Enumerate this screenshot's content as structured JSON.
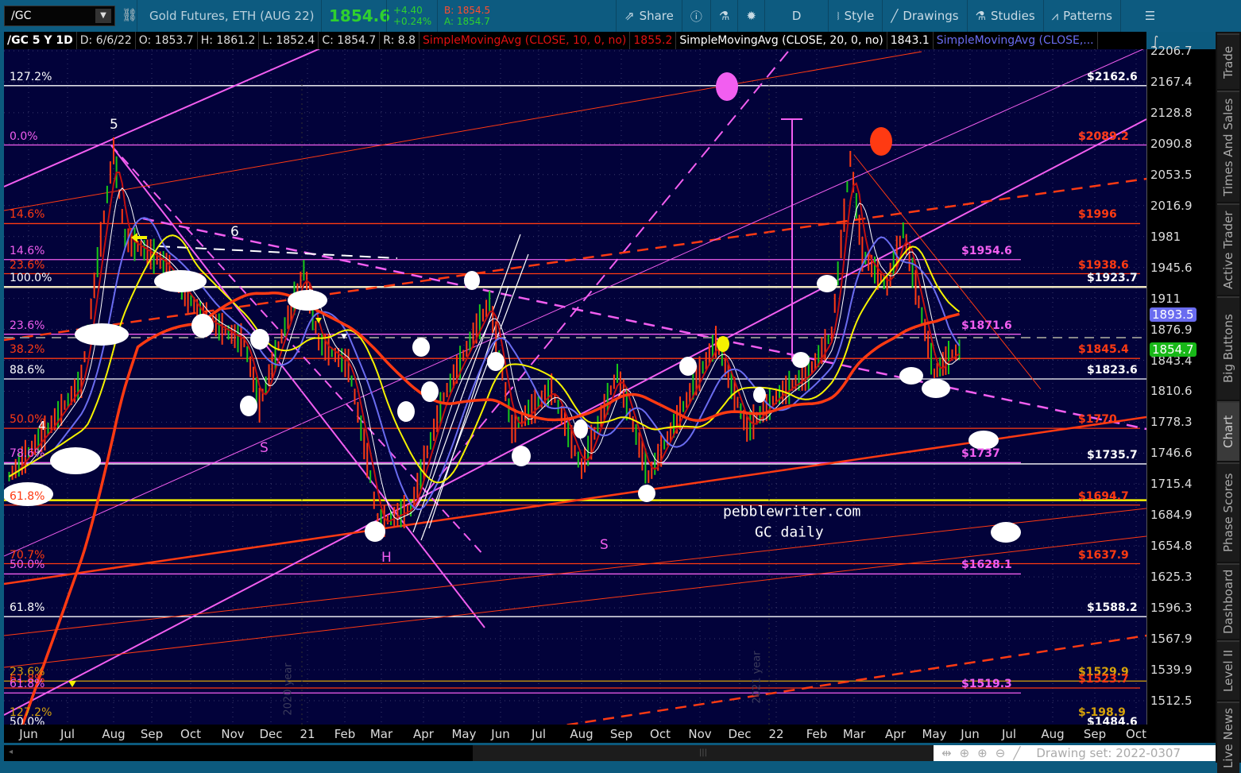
{
  "toolbar": {
    "symbol": "/GC",
    "description": "Gold Futures, ETH (AUG 22)",
    "last": "1854.6",
    "change": "+4.40",
    "change_pct": "+0.24%",
    "bid": "B: 1854.5",
    "ask": "A: 1854.7",
    "share": "Share",
    "aggregation": "D",
    "style": "Style",
    "drawings": "Drawings",
    "studies": "Studies",
    "patterns": "Patterns"
  },
  "infobar": {
    "title": "/GC 5 Y 1D",
    "date": "D: 6/6/22",
    "open": "O: 1853.7",
    "high": "H: 1861.2",
    "low": "L: 1852.4",
    "close": "C: 1854.7",
    "range": "R: 8.8",
    "sma10": "SimpleMovingAvg (CLOSE, 10, 0, no)",
    "sma10_val": "1855.2",
    "sma20": "SimpleMovingAvg (CLOSE, 20, 0, no)",
    "sma20_val": "1843.1",
    "sma_more": "SimpleMovingAvg (CLOSE,..."
  },
  "colors": {
    "white": "#ffffff",
    "pink": "#f25ef0",
    "orange": "#ff3a12",
    "gold": "#d6a20a",
    "yellow": "#f5f200",
    "cream": "#efe6c0",
    "blue": "#6a6cf0",
    "green": "#18b818",
    "bg": "#02023a"
  },
  "chart_data": {
    "type": "line",
    "title": "/GC 5 Y 1D",
    "y_ticks": [
      "2206.7",
      "2167.4",
      "2128.8",
      "2090.8",
      "2053.5",
      "2016.9",
      "1981",
      "1945.6",
      "1911",
      "1876.9",
      "1843.4",
      "1810.6",
      "1778.3",
      "1746.6",
      "1715.4",
      "1684.9",
      "1654.8",
      "1625.3",
      "1596.3",
      "1567.9",
      "1539.9",
      "1512.5"
    ],
    "x_ticks": [
      "Jun",
      "Jul",
      "Aug",
      "Sep",
      "Oct",
      "Nov",
      "Dec",
      "21",
      "Feb",
      "Mar",
      "Apr",
      "May",
      "Jun",
      "Jul",
      "Aug",
      "Sep",
      "Oct",
      "Nov",
      "Dec",
      "22",
      "Feb",
      "Mar",
      "Apr",
      "May",
      "Jun",
      "Jul",
      "Aug",
      "Sep",
      "Oct"
    ],
    "x_unit": "months since Jun 2020",
    "price": [
      [
        -0.5,
        1722.9
      ],
      [
        0.5,
        1771.3
      ],
      [
        1.3,
        1821.1
      ],
      [
        2.0,
        2082.2
      ],
      [
        2.3,
        1978.9
      ],
      [
        3.3,
        1951.6
      ],
      [
        4.3,
        1889.5
      ],
      [
        5.3,
        1863.5
      ],
      [
        5.7,
        1796.1
      ],
      [
        6.9,
        1942.5
      ],
      [
        7.3,
        1863.5
      ],
      [
        8.1,
        1837.8
      ],
      [
        8.7,
        1722.9
      ],
      [
        8.9,
        1675.9
      ],
      [
        9.7,
        1691.3
      ],
      [
        10.5,
        1804.5
      ],
      [
        11.7,
        1907.2
      ],
      [
        12.3,
        1771.3
      ],
      [
        13.3,
        1812.6
      ],
      [
        14.0,
        1731.0
      ],
      [
        14.9,
        1829.6
      ],
      [
        15.7,
        1722.9
      ],
      [
        16.5,
        1787.7
      ],
      [
        17.4,
        1863.5
      ],
      [
        18.2,
        1771.3
      ],
      [
        19.0,
        1804.5
      ],
      [
        19.8,
        1829.6
      ],
      [
        20.4,
        1872.2
      ],
      [
        20.9,
        2072.5
      ],
      [
        21.2,
        1960.8
      ],
      [
        21.8,
        1924.8
      ],
      [
        22.2,
        1988.2
      ],
      [
        22.6,
        1907.2
      ],
      [
        23.0,
        1829.6
      ],
      [
        23.4,
        1846.4
      ],
      [
        23.7,
        1854.7
      ]
    ],
    "levels": [
      {
        "pct": "127.2%",
        "pct_color": "white",
        "label": "$2162.6",
        "label_color": "white",
        "price": 2162.6,
        "line": "white",
        "span": "full"
      },
      {
        "pct": "0.0%",
        "pct_color": "pink",
        "label": "$2089.2",
        "label_color": "pink",
        "label2": "$2089.2",
        "price": 2089.2,
        "line": "pink",
        "span": "full"
      },
      {
        "pct": "14.6%",
        "pct_color": "orange",
        "label": "$1996",
        "label_color": "orange",
        "price": 1996,
        "line": "orange",
        "span": "long"
      },
      {
        "pct": "14.6%",
        "pct_color": "pink",
        "label": "$1954.6",
        "label_color": "pink",
        "price": 1954.6,
        "line": "pink",
        "span": "short"
      },
      {
        "pct": "23.6%",
        "pct_color": "orange",
        "label": "$1938.6",
        "label_color": "orange",
        "price": 1938.6,
        "line": "orange",
        "span": "long"
      },
      {
        "pct": "100.0%",
        "pct_color": "white",
        "label": "$1923.7",
        "label_color": "white",
        "price": 1923.7,
        "line": "cream",
        "span": "full"
      },
      {
        "pct": "23.6%",
        "pct_color": "pink",
        "label": "$1871.6",
        "label_color": "pink",
        "price": 1871.6,
        "line": "pink",
        "span": "short"
      },
      {
        "pct": "38.2%",
        "pct_color": "orange",
        "label": "$1845.4",
        "label_color": "orange",
        "price": 1845.4,
        "line": "orange",
        "span": "long"
      },
      {
        "pct": "88.6%",
        "pct_color": "white",
        "label": "$1823.6",
        "label_color": "white",
        "price": 1823.6,
        "line": "white",
        "span": "full"
      },
      {
        "pct": "50.0%",
        "pct_color": "orange",
        "label": "$1770",
        "label_color": "orange",
        "price": 1772,
        "line": "orange",
        "span": "long"
      },
      {
        "pct": "78.6%",
        "pct_color": "pink",
        "label": "$1737",
        "label_color": "pink",
        "price": 1737,
        "line": "pink",
        "span": "short"
      },
      {
        "pct": "",
        "pct_color": "white",
        "label": "$1735.7",
        "label_color": "white",
        "price": 1735.7,
        "line": "white",
        "span": "full"
      },
      {
        "pct": "",
        "pct_color": "yellow",
        "label": "",
        "label_color": "yellow",
        "price": 1699.5,
        "line": "yellow",
        "span": "full"
      },
      {
        "pct": "61.8%",
        "pct_color": "orange",
        "label": "$1694.7",
        "label_color": "orange",
        "price": 1694.7,
        "line": "orange",
        "span": "long"
      },
      {
        "pct": "70.7%",
        "pct_color": "orange",
        "label": "$1637.9",
        "label_color": "orange",
        "price": 1637.9,
        "line": "orange",
        "span": "long"
      },
      {
        "pct": "50.0%",
        "pct_color": "pink",
        "label": "$1628.1",
        "label_color": "pink",
        "price": 1628.1,
        "line": "pink",
        "span": "short"
      },
      {
        "pct": "61.8%",
        "pct_color": "white",
        "label": "$1588.2",
        "label_color": "white",
        "price": 1588.2,
        "line": "white",
        "span": "full"
      },
      {
        "pct": "23.6%",
        "pct_color": "gold",
        "label": "$1529.9",
        "label_color": "gold",
        "price": 1529.9,
        "line": "gold",
        "span": "full"
      },
      {
        "pct": "61.8%",
        "pct_color": "orange",
        "label": "$1523.7",
        "label_color": "orange",
        "price": 1523.7,
        "line": "orange",
        "span": "long"
      },
      {
        "pct": "61.8%",
        "pct_color": "pink",
        "label": "$1519.3",
        "label_color": "pink",
        "price": 1519.3,
        "line": "pink",
        "span": "short"
      },
      {
        "pct": "127.2%",
        "pct_color": "gold",
        "label": "$-198.9",
        "label_color": "gold",
        "price": 1494,
        "line": "none",
        "span": "none"
      },
      {
        "pct": "50.0%",
        "pct_color": "white",
        "label": "$1484.6",
        "label_color": "white",
        "price": 1486,
        "line": "none",
        "span": "none"
      }
    ],
    "price_badges": [
      {
        "value": "1893.5",
        "color": "blue"
      },
      {
        "value": "1854.7",
        "color": "green"
      }
    ],
    "annotations": {
      "wave5": "5",
      "wave6": "6",
      "wave4": "4",
      "s1": "S",
      "h": "H",
      "s2": "S",
      "site": "pebblewriter.com",
      "caption": "GC daily",
      "year2020": "2020 year",
      "year2021": "2021 year"
    }
  },
  "status": {
    "drawing_set": "Drawing set: 2022-0307"
  },
  "sidebar": {
    "tabs": [
      "Trade",
      "Times And Sales",
      "Active Trader",
      "Big Buttons",
      "Chart",
      "Phase Scores",
      "Dashboard",
      "Level II",
      "Live News"
    ],
    "selected": "Chart"
  }
}
